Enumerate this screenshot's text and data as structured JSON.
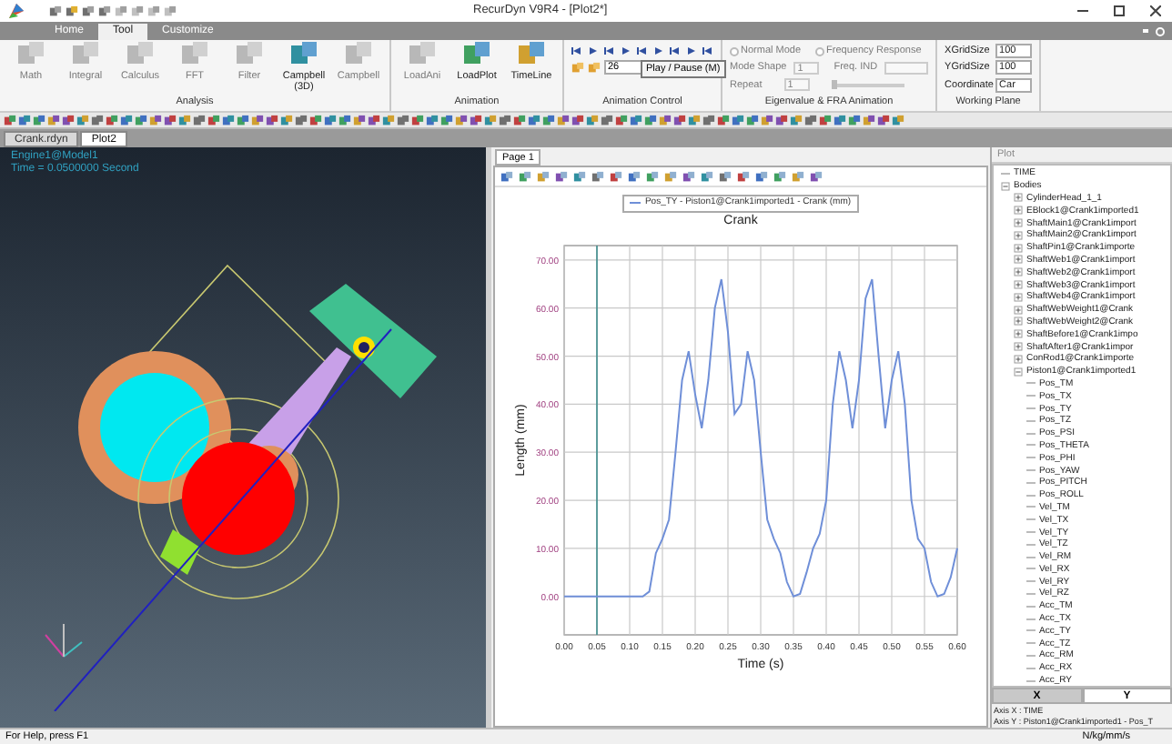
{
  "window": {
    "title": "RecurDyn V9R4 - [Plot2*]"
  },
  "ribbon_tabs": [
    {
      "label": "Home",
      "selected": false
    },
    {
      "label": "Tool",
      "selected": true
    },
    {
      "label": "Customize",
      "selected": false
    }
  ],
  "ribbon_groups": [
    {
      "kind": "buttons",
      "label": "Analysis",
      "buttons": [
        {
          "label": "Math",
          "disabled": true
        },
        {
          "label": "Integral",
          "disabled": true
        },
        {
          "label": "Calculus",
          "disabled": true
        },
        {
          "label": "FFT",
          "disabled": true
        },
        {
          "label": "Filter",
          "disabled": true
        },
        {
          "label": "Campbell (3D)",
          "disabled": false
        },
        {
          "label": "Campbell",
          "disabled": true
        }
      ]
    },
    {
      "kind": "buttons",
      "label": "Animation",
      "buttons": [
        {
          "label": "LoadAni",
          "disabled": true
        },
        {
          "label": "LoadPlot",
          "disabled": false
        },
        {
          "label": "TimeLine",
          "disabled": false
        }
      ]
    },
    {
      "kind": "playback",
      "label": "Animation Control",
      "frame": "26",
      "tooltip": "Play / Pause (M)"
    },
    {
      "kind": "eigen",
      "label": "Eigenvalue & FRA Animation",
      "disabled": true,
      "radios": [
        "Normal Mode",
        "Frequency Response"
      ],
      "mode_shape_label": "Mode Shape",
      "mode_shape": "1",
      "freq_label": "Freq. IND",
      "repeat_label": "Repeat",
      "repeat": "1",
      "slider": {
        "level": 0
      }
    },
    {
      "kind": "plane",
      "label": "Working Plane",
      "fields": [
        {
          "label": "XGridSize",
          "value": "100"
        },
        {
          "label": "YGridSize",
          "value": "100"
        },
        {
          "label": "Coordinate",
          "value": "Car"
        }
      ]
    }
  ],
  "doc_tabs": [
    {
      "label": "Crank.rdyn",
      "selected": false
    },
    {
      "label": "Plot2",
      "selected": true
    }
  ],
  "viewport": {
    "model": "Engine1@Model1",
    "time": "Time = 0.0500000 Second"
  },
  "plot": {
    "page_tabs": [
      {
        "label": "Page 1",
        "selected": true
      }
    ],
    "chart_data": {
      "type": "line",
      "grid": true,
      "title": "Crank",
      "xlabel": "Time (s)",
      "ylabel": "Length (mm)",
      "xlim": [
        0,
        0.6
      ],
      "ylim": [
        -8,
        73
      ],
      "xticks": [
        {
          "value": 0,
          "label": "0.00"
        },
        {
          "value": 0.05,
          "label": "0.05"
        },
        {
          "value": 0.1,
          "label": "0.10"
        },
        {
          "value": 0.15,
          "label": "0.15"
        },
        {
          "value": 0.2,
          "label": "0.20"
        },
        {
          "value": 0.25,
          "label": "0.25"
        },
        {
          "value": 0.3,
          "label": "0.30"
        },
        {
          "value": 0.35,
          "label": "0.35"
        },
        {
          "value": 0.4,
          "label": "0.40"
        },
        {
          "value": 0.45,
          "label": "0.45"
        },
        {
          "value": 0.5,
          "label": "0.50"
        },
        {
          "value": 0.55,
          "label": "0.55"
        },
        {
          "value": 0.6,
          "label": "0.60"
        }
      ],
      "yticks": [
        {
          "value": 0,
          "label": "0.00"
        },
        {
          "value": 10,
          "label": "10.00"
        },
        {
          "value": 20,
          "label": "20.00"
        },
        {
          "value": 30,
          "label": "30.00"
        },
        {
          "value": 40,
          "label": "40.00"
        },
        {
          "value": 50,
          "label": "50.00"
        },
        {
          "value": 60,
          "label": "60.00"
        },
        {
          "value": 70,
          "label": "70.00"
        }
      ],
      "x": [
        0,
        0.01,
        0.02,
        0.03,
        0.04,
        0.05,
        0.06,
        0.07,
        0.08,
        0.09,
        0.1,
        0.11,
        0.12,
        0.13,
        0.14,
        0.15,
        0.16,
        0.17,
        0.18,
        0.19,
        0.2,
        0.21,
        0.22,
        0.23,
        0.24,
        0.25,
        0.26,
        0.27,
        0.28,
        0.29,
        0.3,
        0.31,
        0.32,
        0.33,
        0.34,
        0.35,
        0.36,
        0.37,
        0.38,
        0.39,
        0.4,
        0.41,
        0.42,
        0.43,
        0.44,
        0.45,
        0.46,
        0.47,
        0.48,
        0.49,
        0.5,
        0.51,
        0.52,
        0.53,
        0.54,
        0.55,
        0.56,
        0.57,
        0.58,
        0.59,
        0.6
      ],
      "series": [
        {
          "name": "Pos_TY - Piston1@Crank1imported1 - Crank (mm)",
          "color": "#6f8fd8",
          "values": [
            0,
            0,
            0,
            0,
            0,
            0,
            0,
            0,
            0,
            0,
            0,
            0,
            0,
            1,
            9,
            12,
            16,
            30,
            45,
            51,
            42,
            35,
            45,
            60,
            66,
            55,
            38,
            40,
            51,
            45,
            30,
            16,
            12,
            9,
            3,
            0,
            0.5,
            5,
            10,
            13,
            20,
            40,
            51,
            45,
            35,
            45,
            62,
            66,
            50,
            35,
            45,
            51,
            40,
            20,
            12,
            10,
            3,
            0,
            0.5,
            4,
            10
          ]
        }
      ],
      "ref_lines": [
        {
          "axis": "x",
          "value": 0.05
        }
      ]
    }
  },
  "plot_panel": {
    "title": "Plot",
    "tree": [
      {
        "label": "TIME"
      },
      {
        "label": "Bodies",
        "expanded": true,
        "children": [
          {
            "label": "CylinderHead_1_1",
            "expanded": false
          },
          {
            "label": "EBlock1@Crank1imported1",
            "expanded": false
          },
          {
            "label": "ShaftMain1@Crank1import",
            "expanded": false
          },
          {
            "label": "ShaftMain2@Crank1import",
            "expanded": false
          },
          {
            "label": "ShaftPin1@Crank1importe",
            "expanded": false
          },
          {
            "label": "ShaftWeb1@Crank1import",
            "expanded": false
          },
          {
            "label": "ShaftWeb2@Crank1import",
            "expanded": false
          },
          {
            "label": "ShaftWeb3@Crank1import",
            "expanded": false
          },
          {
            "label": "ShaftWeb4@Crank1import",
            "expanded": false
          },
          {
            "label": "ShaftWebWeight1@Crank",
            "expanded": false
          },
          {
            "label": "ShaftWebWeight2@Crank",
            "expanded": false
          },
          {
            "label": "ShaftBefore1@Crank1impo",
            "expanded": false
          },
          {
            "label": "ShaftAfter1@Crank1impor",
            "expanded": false
          },
          {
            "label": "ConRod1@Crank1importe",
            "expanded": false
          },
          {
            "label": "Piston1@Crank1imported1",
            "expanded": true,
            "children": [
              {
                "label": "Pos_TM"
              },
              {
                "label": "Pos_TX"
              },
              {
                "label": "Pos_TY"
              },
              {
                "label": "Pos_TZ"
              },
              {
                "label": "Pos_PSI"
              },
              {
                "label": "Pos_THETA"
              },
              {
                "label": "Pos_PHI"
              },
              {
                "label": "Pos_YAW"
              },
              {
                "label": "Pos_PITCH"
              },
              {
                "label": "Pos_ROLL"
              },
              {
                "label": "Vel_TM"
              },
              {
                "label": "Vel_TX"
              },
              {
                "label": "Vel_TY"
              },
              {
                "label": "Vel_TZ"
              },
              {
                "label": "Vel_RM"
              },
              {
                "label": "Vel_RX"
              },
              {
                "label": "Vel_RY"
              },
              {
                "label": "Vel_RZ"
              },
              {
                "label": "Acc_TM"
              },
              {
                "label": "Acc_TX"
              },
              {
                "label": "Acc_TY"
              },
              {
                "label": "Acc_TZ"
              },
              {
                "label": "Acc_RM"
              },
              {
                "label": "Acc_RX"
              },
              {
                "label": "Acc_RY"
              }
            ]
          }
        ]
      }
    ],
    "axis_tabs": [
      {
        "label": "X",
        "selected": true
      },
      {
        "label": "Y",
        "selected": false
      }
    ],
    "axis_info": [
      "Axis X : TIME",
      "Axis Y : Piston1@Crank1imported1 - Pos_T"
    ]
  },
  "status_bar": {
    "help": "For Help, press F1",
    "units": "N/kg/mm/s"
  }
}
